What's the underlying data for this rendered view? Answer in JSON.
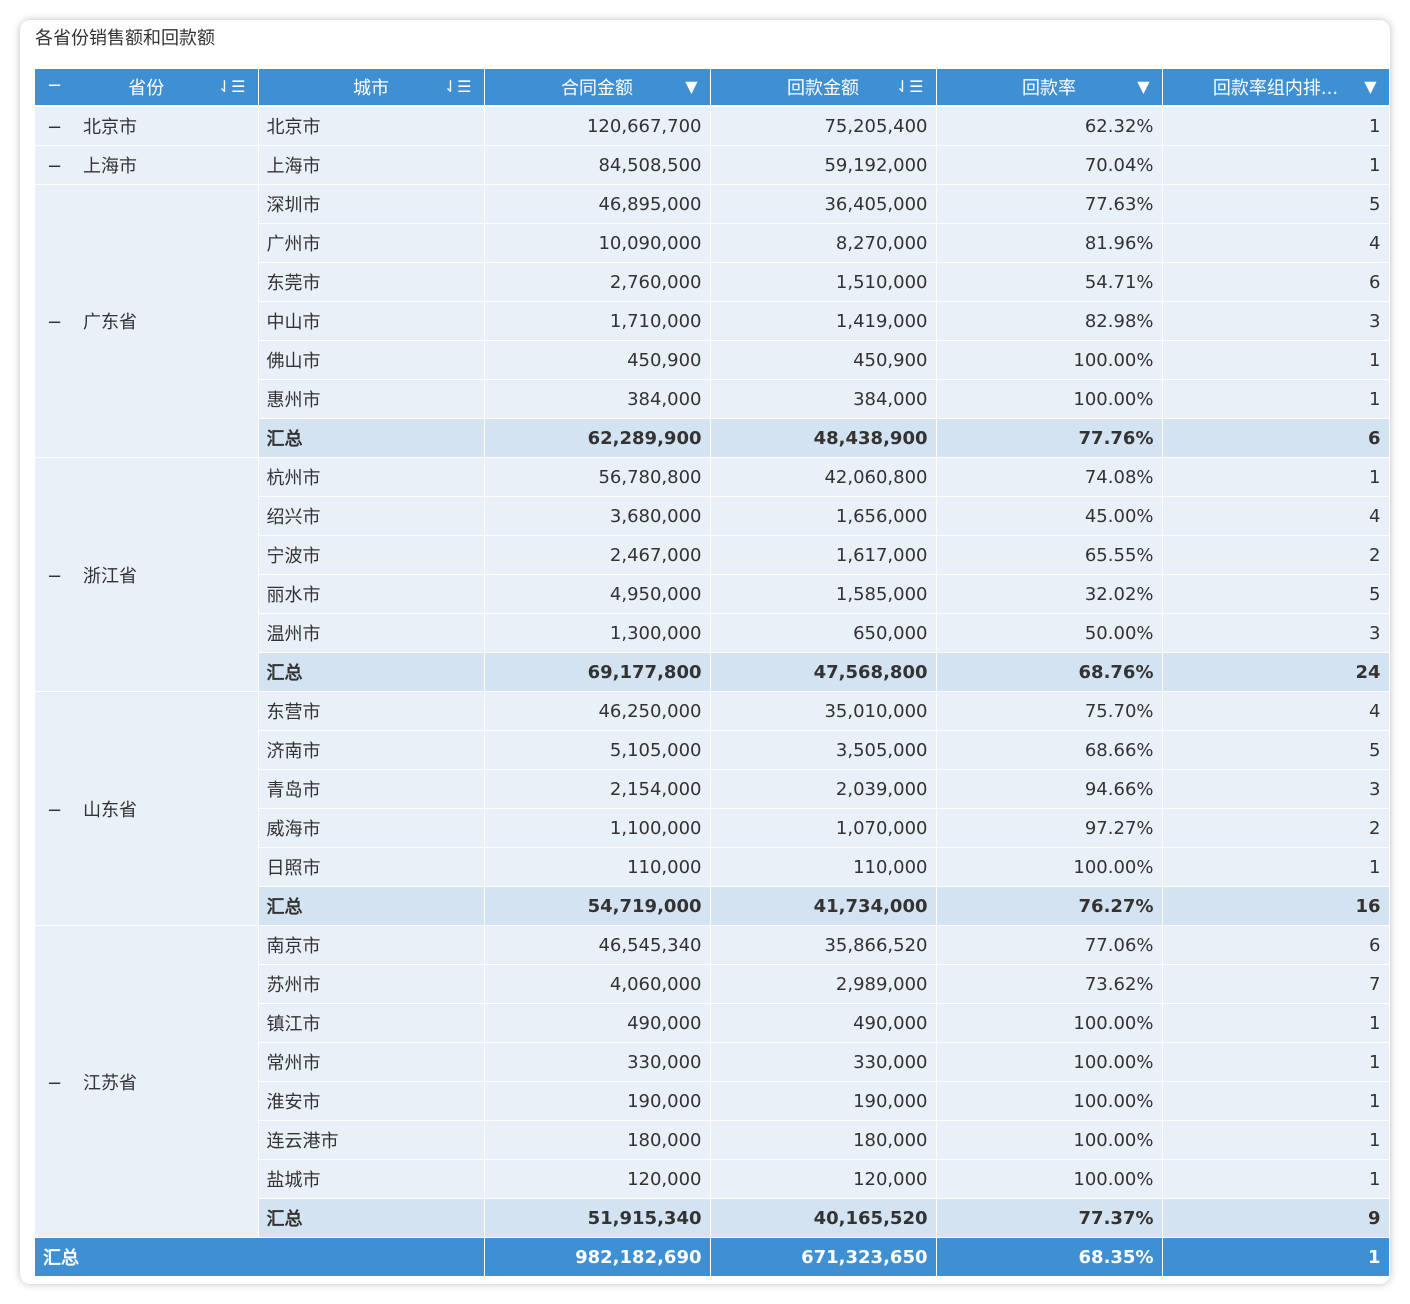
{
  "title": "各省份销售额和回款额",
  "headers": {
    "collapse": "−",
    "province": "省份",
    "city": "城市",
    "contract": "合同金额",
    "payment": "回款金额",
    "rate": "回款率",
    "rank": "回款率组内排..."
  },
  "icons": {
    "sort": "sort-icon",
    "dropdown": "dropdown-triangle-icon",
    "minus": "collapse-minus-icon"
  },
  "colors": {
    "header_bg": "#3f8fd3",
    "cell_bg": "#e9f0f8",
    "subtotal_bg": "#d4e3f1"
  },
  "groups": [
    {
      "province": "北京市",
      "rows": [
        {
          "city": "北京市",
          "contract": "120,667,700",
          "payment": "75,205,400",
          "rate": "62.32%",
          "rank": "1"
        }
      ]
    },
    {
      "province": "上海市",
      "rows": [
        {
          "city": "上海市",
          "contract": "84,508,500",
          "payment": "59,192,000",
          "rate": "70.04%",
          "rank": "1"
        }
      ]
    },
    {
      "province": "广东省",
      "rows": [
        {
          "city": "深圳市",
          "contract": "46,895,000",
          "payment": "36,405,000",
          "rate": "77.63%",
          "rank": "5"
        },
        {
          "city": "广州市",
          "contract": "10,090,000",
          "payment": "8,270,000",
          "rate": "81.96%",
          "rank": "4"
        },
        {
          "city": "东莞市",
          "contract": "2,760,000",
          "payment": "1,510,000",
          "rate": "54.71%",
          "rank": "6"
        },
        {
          "city": "中山市",
          "contract": "1,710,000",
          "payment": "1,419,000",
          "rate": "82.98%",
          "rank": "3"
        },
        {
          "city": "佛山市",
          "contract": "450,900",
          "payment": "450,900",
          "rate": "100.00%",
          "rank": "1"
        },
        {
          "city": "惠州市",
          "contract": "384,000",
          "payment": "384,000",
          "rate": "100.00%",
          "rank": "1"
        }
      ],
      "subtotal": {
        "label": "汇总",
        "contract": "62,289,900",
        "payment": "48,438,900",
        "rate": "77.76%",
        "rank": "6"
      }
    },
    {
      "province": "浙江省",
      "rows": [
        {
          "city": "杭州市",
          "contract": "56,780,800",
          "payment": "42,060,800",
          "rate": "74.08%",
          "rank": "1"
        },
        {
          "city": "绍兴市",
          "contract": "3,680,000",
          "payment": "1,656,000",
          "rate": "45.00%",
          "rank": "4"
        },
        {
          "city": "宁波市",
          "contract": "2,467,000",
          "payment": "1,617,000",
          "rate": "65.55%",
          "rank": "2"
        },
        {
          "city": "丽水市",
          "contract": "4,950,000",
          "payment": "1,585,000",
          "rate": "32.02%",
          "rank": "5"
        },
        {
          "city": "温州市",
          "contract": "1,300,000",
          "payment": "650,000",
          "rate": "50.00%",
          "rank": "3"
        }
      ],
      "subtotal": {
        "label": "汇总",
        "contract": "69,177,800",
        "payment": "47,568,800",
        "rate": "68.76%",
        "rank": "24"
      }
    },
    {
      "province": "山东省",
      "rows": [
        {
          "city": "东营市",
          "contract": "46,250,000",
          "payment": "35,010,000",
          "rate": "75.70%",
          "rank": "4"
        },
        {
          "city": "济南市",
          "contract": "5,105,000",
          "payment": "3,505,000",
          "rate": "68.66%",
          "rank": "5"
        },
        {
          "city": "青岛市",
          "contract": "2,154,000",
          "payment": "2,039,000",
          "rate": "94.66%",
          "rank": "3"
        },
        {
          "city": "威海市",
          "contract": "1,100,000",
          "payment": "1,070,000",
          "rate": "97.27%",
          "rank": "2"
        },
        {
          "city": "日照市",
          "contract": "110,000",
          "payment": "110,000",
          "rate": "100.00%",
          "rank": "1"
        }
      ],
      "subtotal": {
        "label": "汇总",
        "contract": "54,719,000",
        "payment": "41,734,000",
        "rate": "76.27%",
        "rank": "16"
      }
    },
    {
      "province": "江苏省",
      "rows": [
        {
          "city": "南京市",
          "contract": "46,545,340",
          "payment": "35,866,520",
          "rate": "77.06%",
          "rank": "6"
        },
        {
          "city": "苏州市",
          "contract": "4,060,000",
          "payment": "2,989,000",
          "rate": "73.62%",
          "rank": "7"
        },
        {
          "city": "镇江市",
          "contract": "490,000",
          "payment": "490,000",
          "rate": "100.00%",
          "rank": "1"
        },
        {
          "city": "常州市",
          "contract": "330,000",
          "payment": "330,000",
          "rate": "100.00%",
          "rank": "1"
        },
        {
          "city": "淮安市",
          "contract": "190,000",
          "payment": "190,000",
          "rate": "100.00%",
          "rank": "1"
        },
        {
          "city": "连云港市",
          "contract": "180,000",
          "payment": "180,000",
          "rate": "100.00%",
          "rank": "1"
        },
        {
          "city": "盐城市",
          "contract": "120,000",
          "payment": "120,000",
          "rate": "100.00%",
          "rank": "1"
        }
      ],
      "subtotal": {
        "label": "汇总",
        "contract": "51,915,340",
        "payment": "40,165,520",
        "rate": "77.37%",
        "rank": "9"
      }
    }
  ],
  "grand_total": {
    "label": "汇总",
    "contract": "982,182,690",
    "payment": "671,323,650",
    "rate": "68.35%",
    "rank": "1"
  }
}
